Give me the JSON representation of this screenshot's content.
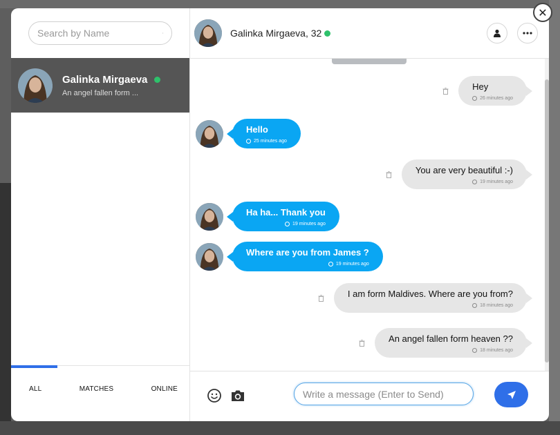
{
  "search": {
    "placeholder": "Search by Name"
  },
  "conversations": [
    {
      "name": "Galinka Mirgaeva",
      "preview": "An angel fallen form ...",
      "online": true
    }
  ],
  "filters": {
    "tabs": [
      "ALL",
      "MATCHES",
      "ONLINE"
    ],
    "active": "ALL"
  },
  "header": {
    "name": "Galinka Mirgaeva, 32",
    "online": true
  },
  "messages": [
    {
      "direction": "out",
      "text": "Hey",
      "time": "26 minutes ago"
    },
    {
      "direction": "in",
      "text": "Hello",
      "time": "25 minutes ago"
    },
    {
      "direction": "out",
      "text": "You are very beautiful :-)",
      "time": "19 minutes ago"
    },
    {
      "direction": "in",
      "text": "Ha ha... Thank you",
      "time": "19 minutes ago"
    },
    {
      "direction": "in",
      "text": "Where are you from James ?",
      "time": "19 minutes ago"
    },
    {
      "direction": "out",
      "text": "I am form Maldives. Where are you from?",
      "time": "18 minutes ago"
    },
    {
      "direction": "out",
      "text": "An angel fallen form heaven ??",
      "time": "18 minutes ago"
    }
  ],
  "composer": {
    "placeholder": "Write a message (Enter to Send)"
  },
  "colors": {
    "accent": "#2f6fe8",
    "incoming_bubble": "#0aa6f3",
    "outgoing_bubble": "#e6e6e6",
    "online": "#2ec16b"
  },
  "icons": [
    "search-icon",
    "user-icon",
    "more-icon",
    "close-icon",
    "trash-icon",
    "clock-icon",
    "emoji-icon",
    "camera-icon",
    "send-icon"
  ]
}
